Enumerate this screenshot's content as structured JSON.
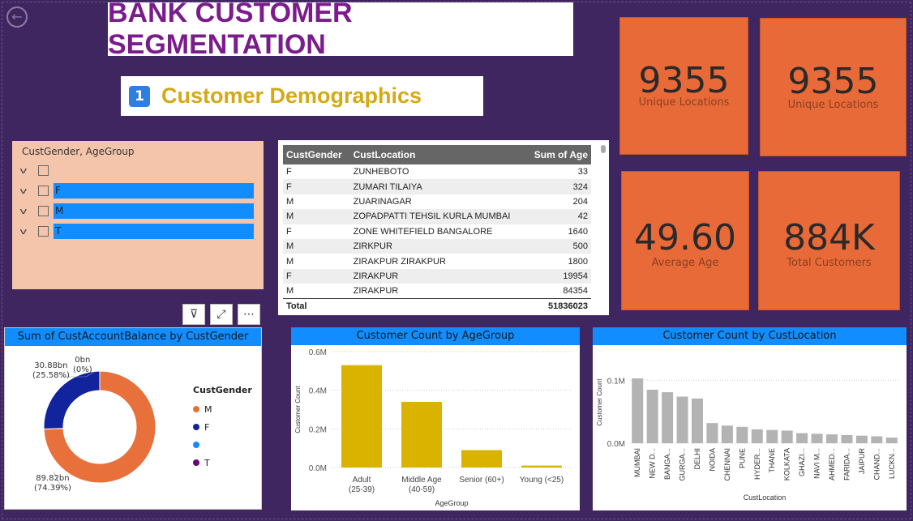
{
  "header": {
    "title": "BANK CUSTOMER SEGMENTATION",
    "section_number": "1",
    "section_title": "Customer Demographics"
  },
  "kpis": [
    {
      "value": "9355",
      "caption": "Unique Locations"
    },
    {
      "value": "9355",
      "caption": "Unique Locations"
    },
    {
      "value": "49.60",
      "caption": "Average Age"
    },
    {
      "value": "884K",
      "caption": "Total Customers"
    }
  ],
  "slicer": {
    "title": "CustGender, AgeGroup",
    "items": [
      "",
      "F",
      "M",
      "T"
    ]
  },
  "table": {
    "columns": [
      "CustGender",
      "CustLocation",
      "Sum of Age"
    ],
    "rows": [
      [
        "F",
        "ZUNHEBOTO",
        "33"
      ],
      [
        "F",
        "ZUMARI TILAIYA",
        "324"
      ],
      [
        "M",
        "ZUARINAGAR",
        "204"
      ],
      [
        "M",
        "ZOPADPATTI TEHSIL KURLA MUMBAI",
        "42"
      ],
      [
        "F",
        "ZONE WHITEFIELD BANGALORE",
        "1640"
      ],
      [
        "M",
        "ZIRKPUR",
        "500"
      ],
      [
        "M",
        "ZIRAKPUR ZIRAKPUR",
        "1800"
      ],
      [
        "F",
        "ZIRAKPUR",
        "19954"
      ],
      [
        "M",
        "ZIRAKPUR",
        "84354"
      ]
    ],
    "total_label": "Total",
    "total_value": "51836023"
  },
  "chart_data": [
    {
      "type": "pie",
      "title": "Sum of CustAccountBalance by CustGender",
      "legend_title": "CustGender",
      "categories": [
        "M",
        "F",
        "",
        "T"
      ],
      "values": [
        89.82,
        30.88,
        0,
        0
      ],
      "labels": [
        "89.82bn",
        "30.88bn",
        "0bn",
        ""
      ],
      "percent_labels": [
        "(74.39%)",
        "(25.58%)",
        "(0%)",
        ""
      ],
      "colors": [
        "#e8703a",
        "#12239e",
        "#118dff",
        "#6b007b"
      ]
    },
    {
      "type": "bar",
      "title": "Customer Count by AgeGroup",
      "xlabel": "AgeGroup",
      "ylabel": "Customer Count",
      "categories": [
        [
          "Adult",
          "(25-39)"
        ],
        [
          "Middle Age",
          "(40-59)"
        ],
        [
          "Senior (60+)"
        ],
        [
          "Young (<25)"
        ]
      ],
      "values": [
        0.53,
        0.34,
        0.09,
        0.01
      ],
      "yticks": [
        "0.0M",
        "0.2M",
        "0.4M",
        "0.6M"
      ],
      "ylim": [
        0,
        0.6
      ],
      "color": "#d9b300"
    },
    {
      "type": "bar",
      "title": "Customer Count by CustLocation",
      "xlabel": "CustLocation",
      "ylabel": "Customer Count",
      "categories": [
        "MUMBAI",
        "NEW D...",
        "BANGA...",
        "GURGA...",
        "DELHI",
        "NOIDA",
        "CHENNAI",
        "PUNE",
        "HYDER...",
        "THANE",
        "KOLKATA",
        "GHAZI...",
        "NAVI M...",
        "AHMED...",
        "FARIDA...",
        "JAIPUR",
        "CHAND...",
        "LUCKN..."
      ],
      "values": [
        0.103,
        0.085,
        0.081,
        0.074,
        0.071,
        0.032,
        0.028,
        0.026,
        0.022,
        0.021,
        0.02,
        0.016,
        0.015,
        0.014,
        0.013,
        0.012,
        0.011,
        0.009
      ],
      "yticks": [
        "0.0M",
        "0.1M"
      ],
      "ylim": [
        0,
        0.13
      ],
      "color": "#b3b3b3"
    }
  ]
}
